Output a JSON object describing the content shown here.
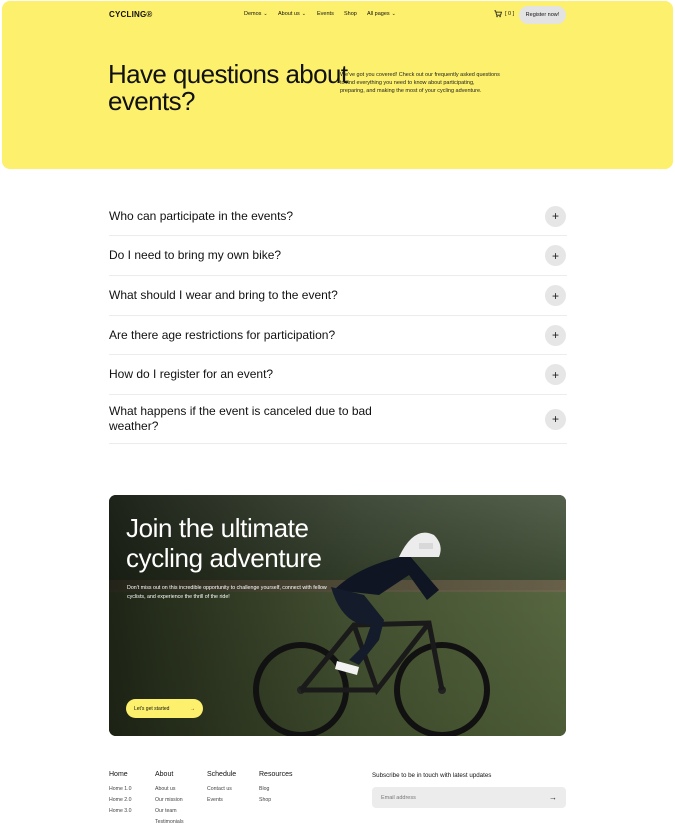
{
  "nav": {
    "logo": "CYCLING®",
    "items": [
      {
        "label": "Demos",
        "has_dropdown": true
      },
      {
        "label": "About us",
        "has_dropdown": true
      },
      {
        "label": "Events",
        "has_dropdown": false
      },
      {
        "label": "Shop",
        "has_dropdown": false
      },
      {
        "label": "All pages",
        "has_dropdown": true
      }
    ],
    "cart_count": "[ 0 ]",
    "register_label": "Register now!"
  },
  "hero": {
    "title": "Have questions about events?",
    "text": "We've got you covered! Check out our frequently asked questions to find everything you need to know about participating, preparing, and making the most of your cycling adventure."
  },
  "faq": [
    {
      "question": "Who can participate in the events?"
    },
    {
      "question": "Do I need to bring my own bike?"
    },
    {
      "question": "What should I wear and bring to the event?"
    },
    {
      "question": "Are there age restrictions for participation?"
    },
    {
      "question": "How do I register for an event?"
    },
    {
      "question": "What happens if the event is canceled due to bad weather?"
    }
  ],
  "banner": {
    "title": "Join the ultimate cycling adventure",
    "text": "Don't miss out on this incredible opportunity to challenge yourself, connect with fellow cyclists, and experience the thrill of the ride!",
    "button_label": "Let's get started",
    "helmet_text": "POC"
  },
  "footer": {
    "columns": [
      {
        "heading": "Home",
        "links": [
          "Home 1.0",
          "Home 2.0",
          "Home 3.0"
        ]
      },
      {
        "heading": "About",
        "links": [
          "About us",
          "Our mission",
          "Our team",
          "Testimonials"
        ]
      },
      {
        "heading": "Schedule",
        "links": [
          "Contact us",
          "Events"
        ]
      },
      {
        "heading": "Resources",
        "links": [
          "Blog",
          "Shop"
        ]
      }
    ],
    "subscribe_title": "Subscribe to be in touch with latest updates",
    "email_placeholder": "Email address"
  },
  "colors": {
    "accent": "#fcf06c",
    "pill": "#e3e3e3"
  }
}
